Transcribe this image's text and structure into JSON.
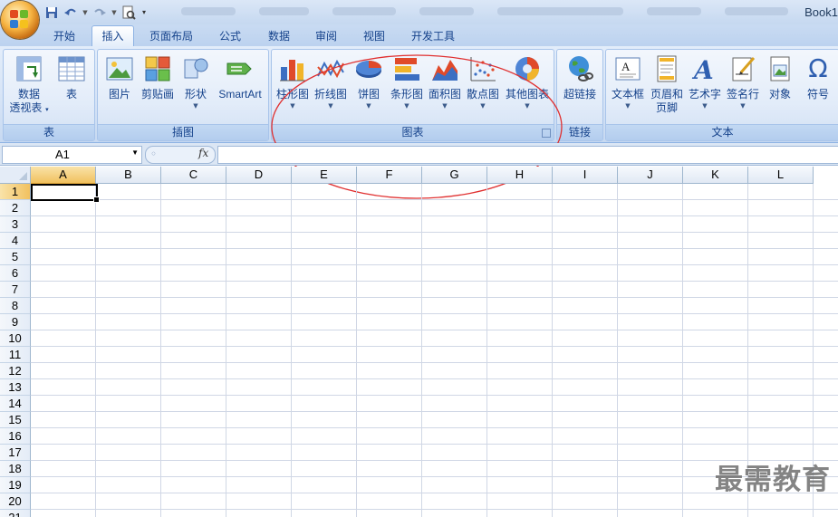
{
  "window": {
    "title": "Book1"
  },
  "tabs": [
    {
      "label": "开始",
      "active": false
    },
    {
      "label": "插入",
      "active": true
    },
    {
      "label": "页面布局",
      "active": false
    },
    {
      "label": "公式",
      "active": false
    },
    {
      "label": "数据",
      "active": false
    },
    {
      "label": "审阅",
      "active": false
    },
    {
      "label": "视图",
      "active": false
    },
    {
      "label": "开发工具",
      "active": false
    }
  ],
  "ribbon": {
    "groups": {
      "table": {
        "label": "表",
        "pivot_line1": "数据",
        "pivot_line2": "透视表",
        "table": "表"
      },
      "illustrations": {
        "label": "插图",
        "picture": "图片",
        "clipart": "剪贴画",
        "shapes": "形状",
        "smartart": "SmartArt"
      },
      "charts": {
        "label": "图表",
        "column": "柱形图",
        "line": "折线图",
        "pie": "饼图",
        "bar": "条形图",
        "area": "面积图",
        "scatter": "散点图",
        "other": "其他图表"
      },
      "links": {
        "label": "链接",
        "hyperlink": "超链接"
      },
      "text": {
        "label": "文本",
        "textbox": "文本框",
        "header_line1": "页眉和",
        "header_line2": "页脚",
        "wordart": "艺术字",
        "signature": "签名行",
        "object": "对象",
        "symbol": "符号",
        "symbol_glyph": "Ω"
      }
    }
  },
  "formula_bar": {
    "name_box": "A1",
    "fx": "fx",
    "formula": ""
  },
  "sheet": {
    "columns": [
      "A",
      "B",
      "C",
      "D",
      "E",
      "F",
      "G",
      "H",
      "I",
      "J",
      "K",
      "L"
    ],
    "rows": [
      "1",
      "2",
      "3",
      "4",
      "5",
      "6",
      "7",
      "8",
      "9",
      "10",
      "11",
      "12",
      "13",
      "14",
      "15",
      "16",
      "17",
      "18",
      "19",
      "20",
      "21"
    ],
    "selected_cell": "A1"
  },
  "annotation": {
    "color": "#e03030"
  },
  "watermark": "最需教育"
}
